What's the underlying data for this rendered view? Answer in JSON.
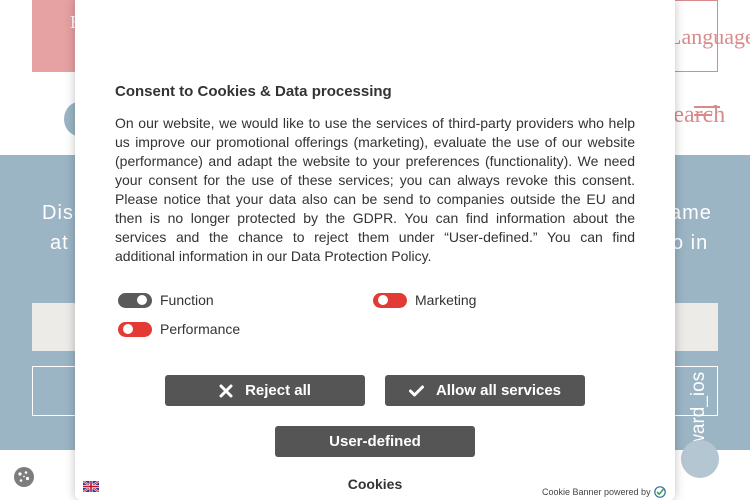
{
  "background": {
    "language_text": "Language",
    "search_text": "Search",
    "band_left_line1": "Disc",
    "band_left_line2": "at",
    "band_right_line1": "ame",
    "band_right_line2": "o in",
    "forward_text": "forward_ios"
  },
  "consent": {
    "title": "Consent to Cookies & Data processing",
    "body": "On our website, we would like to use the services of third-party providers who help us improve our promotional offerings (marketing), evaluate the use of our website (performance) and adapt the website to your preferences (functionality). We need your consent for the use of these services; you can always revoke this consent. Please notice that your data also can be send to companies outside the EU and then is no longer protected by the GDPR. You can find information about the services and the chance to reject them under “User-defined.” You can find additional information in our Data Protection Policy.",
    "toggles": [
      {
        "label": "Function",
        "state": "on"
      },
      {
        "label": "Marketing",
        "state": "off"
      },
      {
        "label": "Performance",
        "state": "off"
      }
    ],
    "reject_label": "Reject all",
    "allow_label": "Allow all services",
    "user_defined_label": "User-defined",
    "footer_title": "Cookies",
    "powered_by": "Cookie Banner powered by"
  },
  "colors": {
    "accent_pink": "#e6a1a3",
    "band_blue": "#9bb5c5",
    "button_gray": "#555555",
    "toggle_on": "#5a5a5a",
    "toggle_off": "#e33a35"
  },
  "icons": {
    "reject": "x-icon",
    "allow": "check-icon",
    "cookie_fab": "cookie-icon",
    "language": "uk-flag-icon",
    "powered_logo": "shield-check-icon",
    "menu": "menu-icon"
  }
}
